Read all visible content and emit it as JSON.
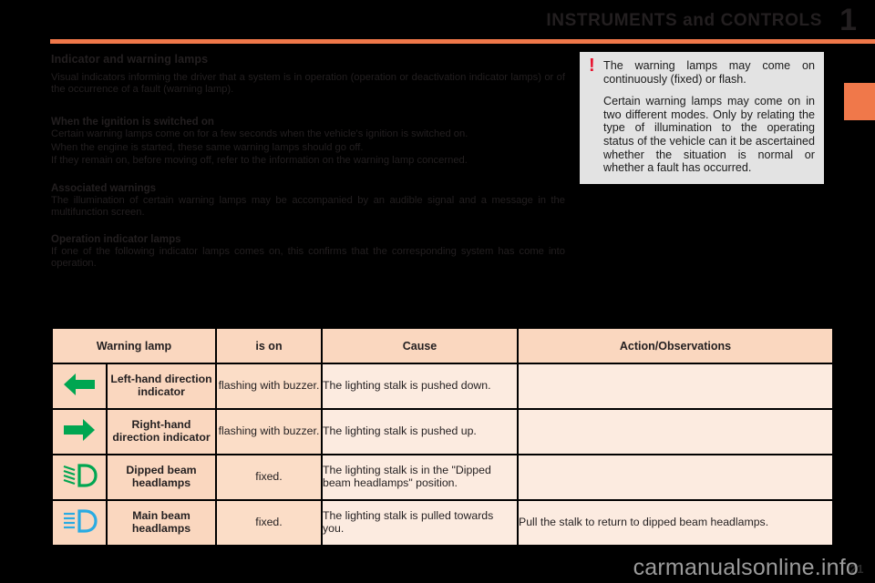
{
  "header": {
    "title": "INSTRUMENTS and CONTROLS",
    "chapter_number": "1"
  },
  "content": {
    "section_title": "Indicator and warning lamps",
    "intro": "Visual indicators informing the driver that a system is in operation (operation or deactivation indicator lamps) or of the occurrence of a fault (warning lamp).",
    "blocks": [
      {
        "heading": "When the ignition is switched on",
        "lines": [
          "Certain warning lamps come on for a few seconds when the vehicle's ignition is switched on.",
          "When the engine is started, these same warning lamps should go off.",
          "If they remain on, before moving off, refer to the information on the warning lamp concerned."
        ]
      },
      {
        "heading": "Associated warnings",
        "lines": [
          "The illumination of certain warning lamps may be accompanied by an audible signal and a message in the multifunction screen."
        ]
      },
      {
        "heading": "Operation indicator lamps",
        "lines": [
          "If one of the following indicator lamps comes on, this confirms that the corresponding system has come into operation."
        ]
      }
    ]
  },
  "callout": {
    "icon": "exclamation-mark-icon",
    "icon_color": "#e8112d",
    "paragraphs": [
      "The warning lamps may come on continuously (fixed) or flash.",
      "Certain warning lamps may come on in two different modes. Only by relating the type of illumination to the operating status of the vehicle can it be ascertained whether the situation is normal or whether a fault has occurred."
    ]
  },
  "table": {
    "headers": [
      "Warning lamp",
      "is on",
      "Cause",
      "Action/Observations"
    ],
    "rows": [
      {
        "icon": "left-arrow-icon",
        "icon_color": "#00a651",
        "lamp": "Left-hand direction indicator",
        "is_on": "flashing with buzzer.",
        "cause": "The lighting stalk is pushed down.",
        "action": ""
      },
      {
        "icon": "right-arrow-icon",
        "icon_color": "#00a651",
        "lamp": "Right-hand direction indicator",
        "is_on": "flashing with buzzer.",
        "cause": "The lighting stalk is pushed up.",
        "action": ""
      },
      {
        "icon": "dipped-beam-headlamp-icon",
        "icon_color": "#00a651",
        "lamp": "Dipped beam headlamps",
        "is_on": "fixed.",
        "cause": "The lighting stalk is in the \"Dipped beam headlamps\" position.",
        "action": ""
      },
      {
        "icon": "main-beam-headlamp-icon",
        "icon_color": "#29abe2",
        "lamp": "Main beam headlamps",
        "is_on": "fixed.",
        "cause": "The lighting stalk is pulled towards you.",
        "action": "Pull the stalk to return to dipped beam headlamps."
      }
    ]
  },
  "footer": {
    "page_number": "21",
    "watermark": "carmanualsonline.info"
  },
  "theme": {
    "accent": "#f0784a",
    "table_header_bg": "#fad7bf",
    "table_cell_bg": "#fcebe0",
    "callout_bg": "#e3e3e3",
    "page_bg": "#000000"
  }
}
